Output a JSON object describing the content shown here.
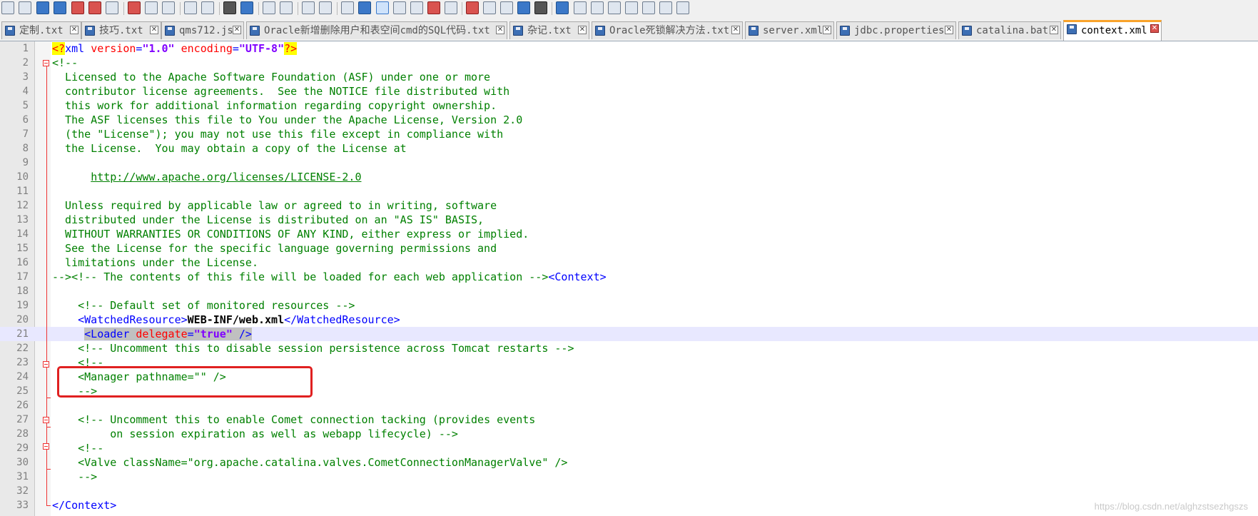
{
  "toolbar": {
    "icons": [
      "new-file-icon",
      "open-file-icon",
      "save-icon",
      "save-all-icon",
      "close-icon",
      "close-all-icon",
      "print-icon",
      "cut-icon",
      "copy-icon",
      "paste-icon",
      "undo-icon",
      "redo-icon",
      "find-icon",
      "replace-icon",
      "zoom-in-icon",
      "zoom-out-icon",
      "sync-vertical-icon",
      "sync-horizontal-icon",
      "word-wrap-icon",
      "show-all-chars-icon",
      "indent-guide-icon",
      "user-lang-icon",
      "function-list-icon",
      "folder-workspace-icon",
      "document-map-icon",
      "record-macro-icon",
      "stop-record-icon",
      "play-macro-icon",
      "run-macro-icon",
      "save-macro-icon",
      "trim-icon",
      "column-icon",
      "move-icon",
      "sort-icon",
      "up-icon",
      "down-icon",
      "split-icon",
      "panel-icon"
    ]
  },
  "tabs": [
    {
      "label": "定制.txt",
      "active": false
    },
    {
      "label": "技巧.txt",
      "active": false
    },
    {
      "label": "qms712.js",
      "active": false
    },
    {
      "label": "Oracle新增删除用户和表空间cmd的SQL代码.txt",
      "active": false
    },
    {
      "label": "杂记.txt",
      "active": false
    },
    {
      "label": "Oracle死锁解决方法.txt",
      "active": false
    },
    {
      "label": "server.xml",
      "active": false
    },
    {
      "label": "jdbc.properties",
      "active": false
    },
    {
      "label": "catalina.bat",
      "active": false
    },
    {
      "label": "context.xml",
      "active": true
    }
  ],
  "close_glyph": "✕",
  "editor": {
    "current_line": 21,
    "lines": [
      [
        [
          "decl",
          "<?"
        ],
        [
          "tag",
          "xml"
        ],
        [
          "plain",
          " "
        ],
        [
          "attr",
          "version"
        ],
        [
          "tag",
          "="
        ],
        [
          "val",
          "\"1.0\""
        ],
        [
          "plain",
          " "
        ],
        [
          "attr",
          "encoding"
        ],
        [
          "tag",
          "="
        ],
        [
          "val",
          "\"UTF-8\""
        ],
        [
          "decl",
          "?>"
        ]
      ],
      [
        [
          "comment",
          "<!--"
        ]
      ],
      [
        [
          "comment",
          "  Licensed to the Apache Software Foundation (ASF) under one or more"
        ]
      ],
      [
        [
          "comment",
          "  contributor license agreements.  See the NOTICE file distributed with"
        ]
      ],
      [
        [
          "comment",
          "  this work for additional information regarding copyright ownership."
        ]
      ],
      [
        [
          "comment",
          "  The ASF licenses this file to You under the Apache License, Version 2.0"
        ]
      ],
      [
        [
          "comment",
          "  (the \"License\"); you may not use this file except in compliance with"
        ]
      ],
      [
        [
          "comment",
          "  the License.  You may obtain a copy of the License at"
        ]
      ],
      [
        [
          "comment",
          ""
        ]
      ],
      [
        [
          "comment",
          "      "
        ],
        [
          "link",
          "http://www.apache.org/licenses/LICENSE-2.0"
        ]
      ],
      [
        [
          "comment",
          ""
        ]
      ],
      [
        [
          "comment",
          "  Unless required by applicable law or agreed to in writing, software"
        ]
      ],
      [
        [
          "comment",
          "  distributed under the License is distributed on an \"AS IS\" BASIS,"
        ]
      ],
      [
        [
          "comment",
          "  WITHOUT WARRANTIES OR CONDITIONS OF ANY KIND, either express or implied."
        ]
      ],
      [
        [
          "comment",
          "  See the License for the specific language governing permissions and"
        ]
      ],
      [
        [
          "comment",
          "  limitations under the License."
        ]
      ],
      [
        [
          "comment",
          "--><!-- The contents of this file will be loaded for each web application -->"
        ],
        [
          "tag",
          "<Context>"
        ]
      ],
      [
        [
          "plain",
          ""
        ]
      ],
      [
        [
          "plain",
          "    "
        ],
        [
          "comment",
          "<!-- Default set of monitored resources -->"
        ]
      ],
      [
        [
          "plain",
          "    "
        ],
        [
          "tag",
          "<WatchedResource>"
        ],
        [
          "text",
          "WEB-INF/web.xml"
        ],
        [
          "tag",
          "</WatchedResource>"
        ]
      ],
      [
        [
          "plain",
          "     "
        ],
        [
          "tagsel",
          "<Loader "
        ],
        [
          "attrsel",
          "delegate"
        ],
        [
          "tagsel",
          "="
        ],
        [
          "valsel",
          "\"true\""
        ],
        [
          "tagsel",
          " />"
        ]
      ],
      [
        [
          "plain",
          "    "
        ],
        [
          "comment",
          "<!-- Uncomment this to disable session persistence across Tomcat restarts -->"
        ]
      ],
      [
        [
          "plain",
          "    "
        ],
        [
          "comment",
          "<!--"
        ]
      ],
      [
        [
          "plain",
          "    "
        ],
        [
          "comment",
          "<Manager pathname=\"\" />"
        ]
      ],
      [
        [
          "plain",
          "    "
        ],
        [
          "comment",
          "-->"
        ]
      ],
      [
        [
          "plain",
          ""
        ]
      ],
      [
        [
          "plain",
          "    "
        ],
        [
          "comment",
          "<!-- Uncomment this to enable Comet connection tacking (provides events"
        ]
      ],
      [
        [
          "plain",
          "         "
        ],
        [
          "comment",
          "on session expiration as well as webapp lifecycle) -->"
        ]
      ],
      [
        [
          "plain",
          "    "
        ],
        [
          "comment",
          "<!--"
        ]
      ],
      [
        [
          "plain",
          "    "
        ],
        [
          "comment",
          "<Valve className=\"org.apache.catalina.valves.CometConnectionManagerValve\" />"
        ]
      ],
      [
        [
          "plain",
          "    "
        ],
        [
          "comment",
          "-->"
        ]
      ],
      [
        [
          "plain",
          ""
        ]
      ],
      [
        [
          "tag",
          "</Context>"
        ]
      ]
    ]
  },
  "watermark": "https://blog.csdn.net/alghzstsezhgszs"
}
